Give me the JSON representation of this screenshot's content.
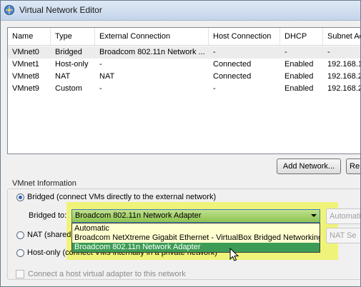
{
  "window": {
    "title": "Virtual Network Editor"
  },
  "table": {
    "headers": [
      "Name",
      "Type",
      "External Connection",
      "Host Connection",
      "DHCP",
      "Subnet Ad"
    ],
    "rows": [
      [
        "VMnet0",
        "Bridged",
        "Broadcom 802.11n Network ...",
        "-",
        "-",
        "-"
      ],
      [
        "VMnet1",
        "Host-only",
        "-",
        "Connected",
        "Enabled",
        "192.168.1"
      ],
      [
        "VMnet8",
        "NAT",
        "NAT",
        "Connected",
        "Enabled",
        "192.168.2"
      ],
      [
        "VMnet9",
        "Custom",
        "-",
        "-",
        "Enabled",
        "192.168.2"
      ]
    ]
  },
  "buttons": {
    "add_network": "Add Network...",
    "remove_partial": "Re",
    "automatic_settings": "Automatic",
    "nat_settings": "NAT Se"
  },
  "vmnet_info": {
    "group_label": "VMnet Information",
    "bridged_label": "Bridged (connect VMs directly to the external network)",
    "bridged_to_label": "Bridged to:",
    "bridged_to_value": "Broadcom 802.11n Network Adapter",
    "nat_label": "NAT (shared",
    "hostonly_label": "Host-only (connect VMs internally in a private network)",
    "connect_host_label": "Connect a host virtual adapter to this network"
  },
  "dropdown_options": [
    "Automatic",
    "Broadcom NetXtreme Gigabit Ethernet - VirtualBox Bridged Networking D",
    "Broadcom 802.11n Network Adapter"
  ],
  "colors": {
    "highlight": "#eff268",
    "combo": "#9dcc5f",
    "selected_option": "#3c9c55"
  }
}
